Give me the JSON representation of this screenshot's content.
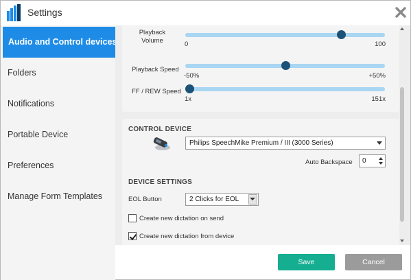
{
  "window": {
    "title": "Settings"
  },
  "sidebar": {
    "items": [
      {
        "label": "Audio and Control devices",
        "active": true
      },
      {
        "label": "Folders"
      },
      {
        "label": "Notifications"
      },
      {
        "label": "Portable Device"
      },
      {
        "label": "Preferences"
      },
      {
        "label": "Manage Form Templates"
      }
    ]
  },
  "audio": {
    "playback_volume": {
      "label_line1": "Playback",
      "label_line2": "Volume",
      "min": "0",
      "max": "100",
      "value": 78
    },
    "playback_speed": {
      "label": "Playback Speed",
      "min": "-50%",
      "max": "+50%",
      "value": 0,
      "min_value": -50,
      "max_value": 50
    },
    "ff_rew_speed": {
      "label": "FF / REW Speed",
      "min": "1x",
      "max": "151x",
      "value": 1,
      "min_value": 1,
      "max_value": 151
    }
  },
  "control_device": {
    "section_title": "CONTROL DEVICE",
    "device": "Philips SpeechMike Premium / III (3000 Series)",
    "auto_backspace_label": "Auto Backspace",
    "auto_backspace_value": "0"
  },
  "device_settings": {
    "section_title": "DEVICE SETTINGS",
    "eol_label": "EOL Button",
    "eol_value": "2 Clicks for EOL",
    "option_send_label": "Create new dictation on send",
    "option_send_checked": false,
    "option_device_label": "Create new dictation from device",
    "option_device_checked": true
  },
  "footer": {
    "save_label": "Save",
    "cancel_label": "Cancel"
  },
  "colors": {
    "accent": "#1e8ce6",
    "save": "#16ae91",
    "cancel": "#9b9b9b",
    "slider_track": "#a9d6f2",
    "slider_thumb": "#1c5277"
  }
}
